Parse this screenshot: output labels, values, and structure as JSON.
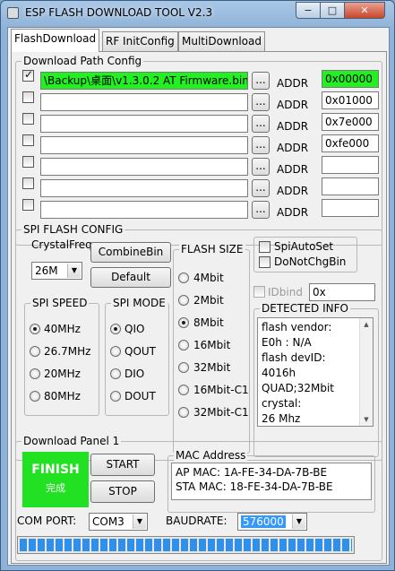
{
  "window": {
    "title": "ESP FLASH DOWNLOAD TOOL V2.3",
    "minimize": "−",
    "maximize": "□",
    "close": "✕"
  },
  "tabs": [
    {
      "label": "FlashDownload",
      "active": true
    },
    {
      "label": "RF InitConfig",
      "active": false
    },
    {
      "label": "MultiDownload",
      "active": false
    }
  ],
  "download_path": {
    "title": "Download Path Config",
    "browse_label": "...",
    "addr_label": "ADDR",
    "rows": [
      {
        "checked": true,
        "path": "\\Backup\\桌面\\v1.3.0.2 AT Firmware.bin",
        "addr": "0x00000",
        "highlight": true
      },
      {
        "checked": false,
        "path": "",
        "addr": "0x01000",
        "highlight": false
      },
      {
        "checked": false,
        "path": "",
        "addr": "0x7e000",
        "highlight": false
      },
      {
        "checked": false,
        "path": "",
        "addr": "0xfe000",
        "highlight": false
      },
      {
        "checked": false,
        "path": "",
        "addr": "",
        "highlight": false
      },
      {
        "checked": false,
        "path": "",
        "addr": "",
        "highlight": false
      },
      {
        "checked": false,
        "path": "",
        "addr": "",
        "highlight": false
      }
    ]
  },
  "spi_config": {
    "title": "SPI FLASH CONFIG",
    "crystal_label": "CrystalFreq",
    "crystal_value": "26M",
    "combine_label": "CombineBin",
    "default_label": "Default",
    "spi_speed": {
      "title": "SPI SPEED",
      "options": [
        {
          "label": "40MHz",
          "selected": true
        },
        {
          "label": "26.7MHz",
          "selected": false
        },
        {
          "label": "20MHz",
          "selected": false
        },
        {
          "label": "80MHz",
          "selected": false
        }
      ]
    },
    "spi_mode": {
      "title": "SPI MODE",
      "options": [
        {
          "label": "QIO",
          "selected": true
        },
        {
          "label": "QOUT",
          "selected": false
        },
        {
          "label": "DIO",
          "selected": false
        },
        {
          "label": "DOUT",
          "selected": false
        }
      ]
    },
    "flash_size": {
      "title": "FLASH SIZE",
      "options": [
        {
          "label": "4Mbit",
          "selected": false
        },
        {
          "label": "2Mbit",
          "selected": false
        },
        {
          "label": "8Mbit",
          "selected": true
        },
        {
          "label": "16Mbit",
          "selected": false
        },
        {
          "label": "32Mbit",
          "selected": false
        },
        {
          "label": "16Mbit-C1",
          "selected": false
        },
        {
          "label": "32Mbit-C1",
          "selected": false
        }
      ]
    },
    "spi_auto_set": {
      "label": "SpiAutoSet",
      "checked": false
    },
    "do_not_chg_bin": {
      "label": "DoNotChgBin",
      "checked": false
    },
    "idbind": {
      "label": "IDbind",
      "checked": false,
      "value": "0x"
    },
    "detected_info": {
      "title": "DETECTED INFO",
      "lines": [
        "flash vendor:",
        "E0h : N/A",
        "flash devID:",
        "4016h",
        "QUAD;32Mbit",
        "crystal:",
        "26 Mhz"
      ]
    }
  },
  "download_panel": {
    "title": "Download Panel 1",
    "status": "FINISH",
    "status_sub": "完成",
    "status_color": "#22e022",
    "start_label": "START",
    "stop_label": "STOP",
    "mac": {
      "title": "MAC Address",
      "ap": "AP  MAC:  1A-FE-34-DA-7B-BE",
      "sta": "STA MAC:  18-FE-34-DA-7B-BE"
    },
    "com_port_label": "COM PORT:",
    "com_port_value": "COM3",
    "baudrate_label": "BAUDRATE:",
    "baudrate_value": "576000",
    "progress_percent": 100
  }
}
